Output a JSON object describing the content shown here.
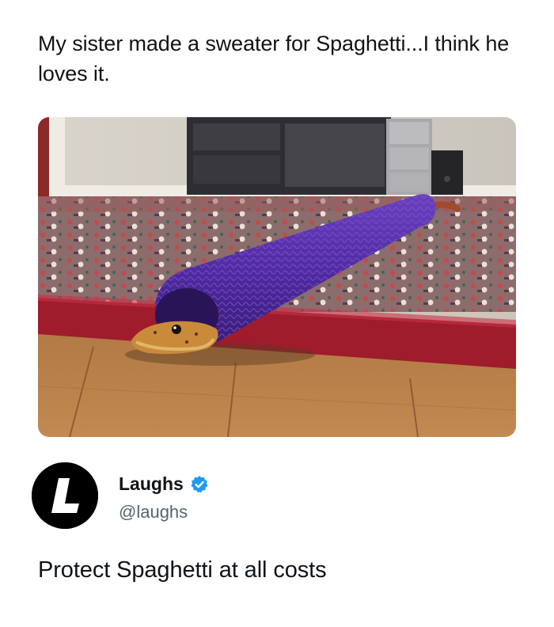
{
  "tweet": {
    "text": "My sister made a sweater for Spaghetti...I think he loves it.",
    "media": {
      "icon": "photo-snake-in-purple-knit-sweater"
    }
  },
  "quote": {
    "display_name": "Laughs",
    "handle": "@laughs",
    "avatar_letter": "L",
    "verified_icon": "verified-badge-icon",
    "verified_color": "#1d9bf0",
    "text": "Protect Spaghetti at all costs"
  },
  "colors": {
    "text_primary": "#0f1419",
    "text_secondary": "#536471",
    "background": "#ffffff"
  }
}
